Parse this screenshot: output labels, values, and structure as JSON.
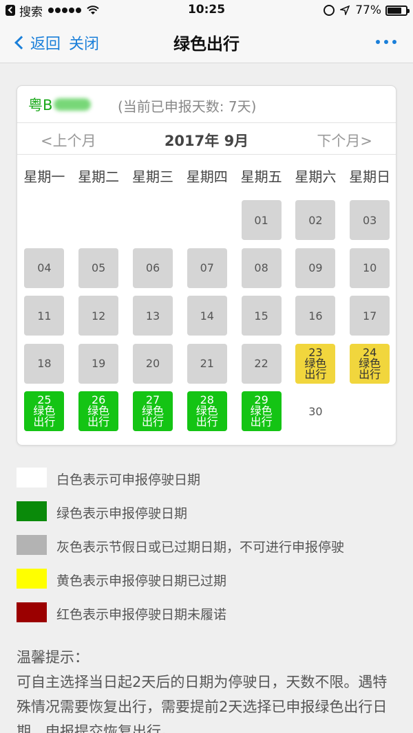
{
  "status_bar": {
    "back_app": "搜索",
    "time": "10:25",
    "battery": "77%",
    "battery_level": 0.77
  },
  "nav": {
    "back_label": "返回",
    "close_label": "关闭",
    "title": "绿色出行"
  },
  "card": {
    "plate_prefix": "粤B",
    "report_days": "(当前已申报天数: 7天)",
    "prev_month": "<上个月",
    "month_title": "2017年 9月",
    "next_month": "下个月>",
    "weekdays": [
      "星期一",
      "星期二",
      "星期三",
      "星期四",
      "星期五",
      "星期六",
      "星期日"
    ],
    "green_label": "绿色",
    "green_label2": "出行",
    "first_weekday_index": 4,
    "days": [
      {
        "day": "01",
        "status": "gray"
      },
      {
        "day": "02",
        "status": "gray"
      },
      {
        "day": "03",
        "status": "gray"
      },
      {
        "day": "04",
        "status": "gray"
      },
      {
        "day": "05",
        "status": "gray"
      },
      {
        "day": "06",
        "status": "gray"
      },
      {
        "day": "07",
        "status": "gray"
      },
      {
        "day": "08",
        "status": "gray"
      },
      {
        "day": "09",
        "status": "gray"
      },
      {
        "day": "10",
        "status": "gray"
      },
      {
        "day": "11",
        "status": "gray"
      },
      {
        "day": "12",
        "status": "gray"
      },
      {
        "day": "13",
        "status": "gray"
      },
      {
        "day": "14",
        "status": "gray"
      },
      {
        "day": "15",
        "status": "gray"
      },
      {
        "day": "16",
        "status": "gray"
      },
      {
        "day": "17",
        "status": "gray"
      },
      {
        "day": "18",
        "status": "gray"
      },
      {
        "day": "19",
        "status": "gray"
      },
      {
        "day": "20",
        "status": "gray"
      },
      {
        "day": "21",
        "status": "gray"
      },
      {
        "day": "22",
        "status": "gray"
      },
      {
        "day": "23",
        "status": "yellow"
      },
      {
        "day": "24",
        "status": "yellow"
      },
      {
        "day": "25",
        "status": "green"
      },
      {
        "day": "26",
        "status": "green"
      },
      {
        "day": "27",
        "status": "green"
      },
      {
        "day": "28",
        "status": "green"
      },
      {
        "day": "29",
        "status": "green"
      },
      {
        "day": "30",
        "status": "white"
      }
    ]
  },
  "legend": [
    {
      "color": "#ffffff",
      "text": "白色表示可申报停驶日期"
    },
    {
      "color": "#0a8a0a",
      "text": "绿色表示申报停驶日期"
    },
    {
      "color": "#b3b3b3",
      "text": "灰色表示节假日或已过期日期，不可进行申报停驶"
    },
    {
      "color": "#ffff00",
      "text": "黄色表示申报停驶日期已过期"
    },
    {
      "color": "#9b0000",
      "text": "红色表示申报停驶日期未履诺"
    }
  ],
  "tips": {
    "title": "温馨提示：",
    "body": "可自主选择当日起2天后的日期为停驶日，天数不限。遇特殊情况需要恢复出行，需要提前2天选择已申报绿色出行日期，申报提交恢复出行。"
  }
}
